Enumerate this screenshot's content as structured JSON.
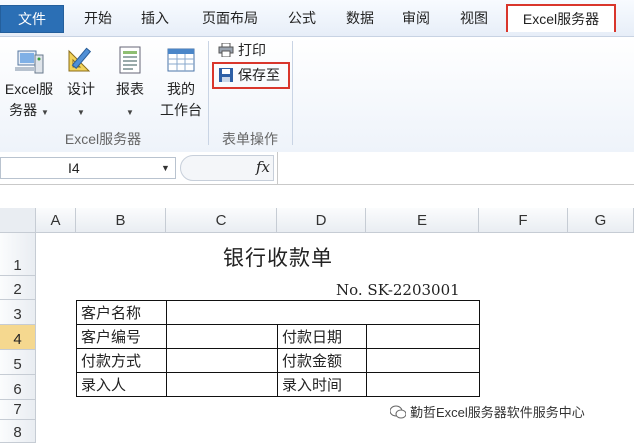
{
  "ribbon_tabs": [
    {
      "label": "文件"
    },
    {
      "label": "开始"
    },
    {
      "label": "插入"
    },
    {
      "label": "页面布局"
    },
    {
      "label": "公式"
    },
    {
      "label": "数据"
    },
    {
      "label": "审阅"
    },
    {
      "label": "视图"
    },
    {
      "label": "Excel服务器"
    }
  ],
  "ribbon": {
    "excel_server": {
      "line1": "Excel服",
      "line2": "务器",
      "icon": "server-icon"
    },
    "design": {
      "line1": "设计",
      "icon": "design-icon"
    },
    "report": {
      "line1": "报表",
      "icon": "report-icon"
    },
    "workbench": {
      "line1": "我的",
      "line2": "工作台",
      "icon": "workbench-icon"
    },
    "group1_label": "Excel服务器",
    "print_label": "打印",
    "save_to_label": "保存至",
    "group2_label": "表单操作",
    "active_tab_highlight": "#d9362c"
  },
  "formula_bar": {
    "name_box": "I4",
    "fx_label": "fx",
    "content": ""
  },
  "sheet": {
    "columns": [
      "A",
      "B",
      "C",
      "D",
      "E",
      "F",
      "G"
    ],
    "rows": [
      "1",
      "2",
      "3",
      "4",
      "5",
      "6",
      "7",
      "8"
    ],
    "selected_row": "4",
    "title": "银行收款单",
    "doc_no": "No. SK-2203001",
    "form": {
      "customer_name": "客户名称",
      "customer_id": "客户编号",
      "payment_date": "付款日期",
      "payment_method": "付款方式",
      "payment_amount": "付款金额",
      "entered_by": "录入人",
      "entry_time": "录入时间"
    }
  },
  "watermark": "勤哲Excel服务器软件服务中心"
}
